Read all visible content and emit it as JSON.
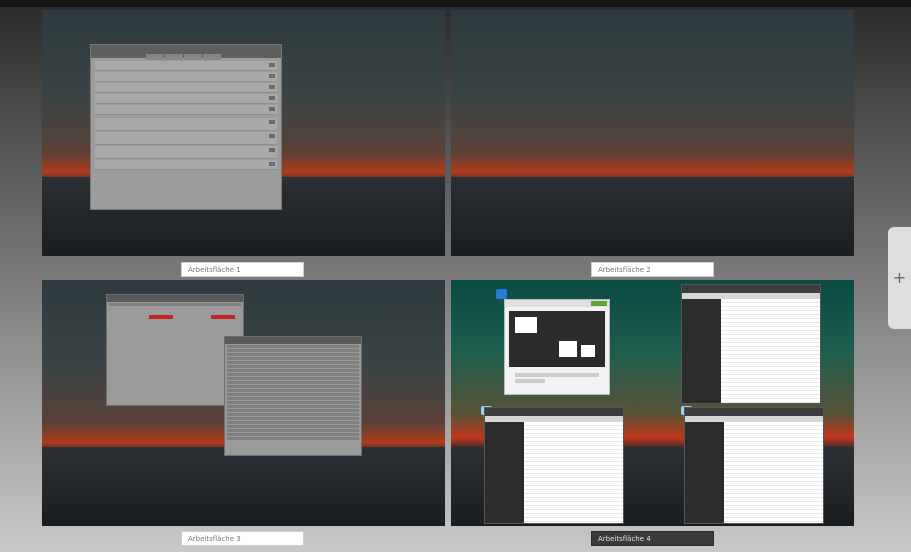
{
  "overview": {
    "add_button_label": "+",
    "workspaces": [
      {
        "label": "Arbeitsfläche 1",
        "active": false
      },
      {
        "label": "Arbeitsfläche 2",
        "active": false
      },
      {
        "label": "Arbeitsfläche 3",
        "active": false
      },
      {
        "label": "Arbeitsfläche 4",
        "active": true
      }
    ]
  },
  "colors": {
    "accent_active_label": "#3a3a3a",
    "sunset": "#b03b1c",
    "terminal_alert": "#c2231e"
  }
}
